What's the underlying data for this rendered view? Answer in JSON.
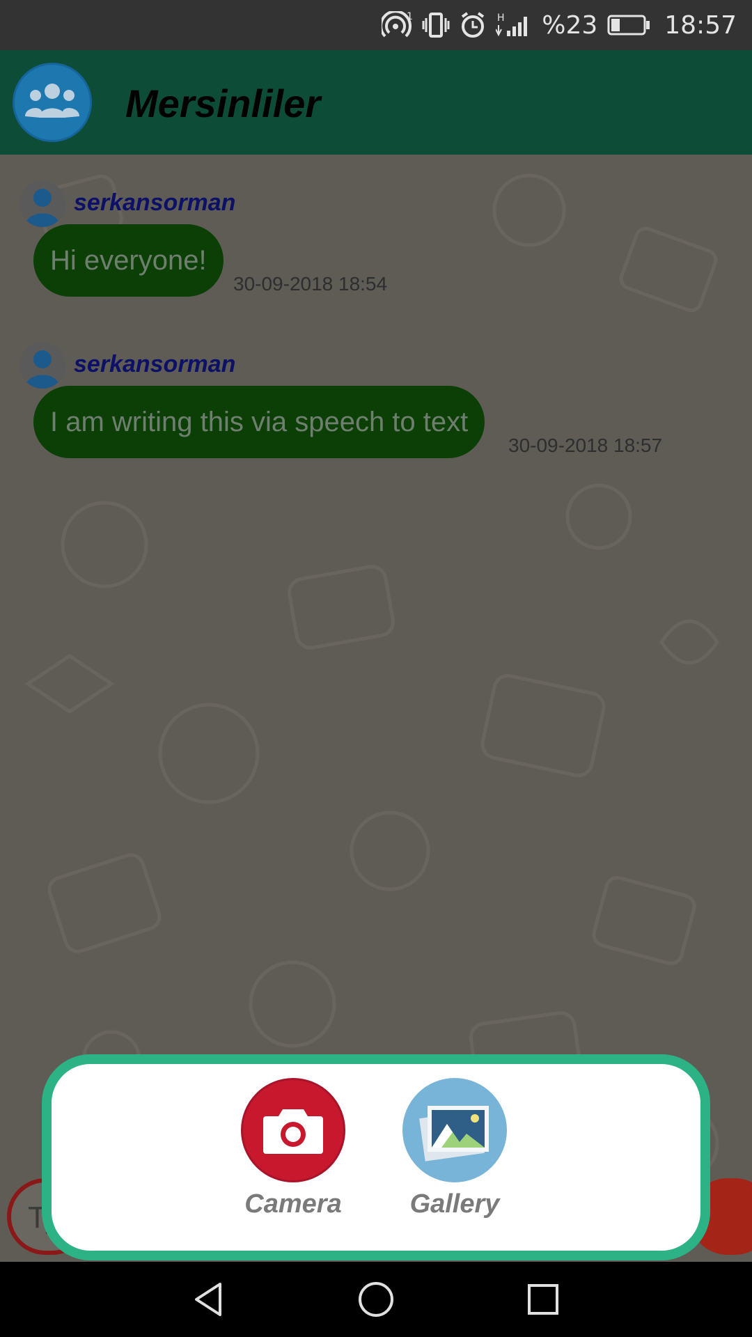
{
  "status_bar": {
    "battery_percent": "%23",
    "time": "18:57",
    "icons": [
      "hotspot-icon",
      "vibrate-icon",
      "alarm-icon",
      "signal-icon",
      "battery-icon"
    ]
  },
  "header": {
    "title": "Mersinliler",
    "avatar_icon": "group-icon"
  },
  "messages": [
    {
      "sender": "serkansorman",
      "text": "Hi everyone!",
      "timestamp": "30-09-2018 18:54"
    },
    {
      "sender": "serkansorman",
      "text": "I am writing this via speech to text",
      "timestamp": "30-09-2018 18:57"
    }
  ],
  "input": {
    "placeholder_visible": "Ty"
  },
  "attachment_dialog": {
    "camera_label": "Camera",
    "gallery_label": "Gallery"
  },
  "colors": {
    "status_bar": "#333333",
    "app_bar": "#0d4d37",
    "bubble": "#0b3f05",
    "sender": "#0c1066",
    "dialog_border": "#2db286",
    "camera": "#c8182e",
    "gallery": "#78b4d8"
  },
  "nav_bar": {
    "icons": [
      "back-icon",
      "home-icon",
      "recents-icon"
    ]
  }
}
